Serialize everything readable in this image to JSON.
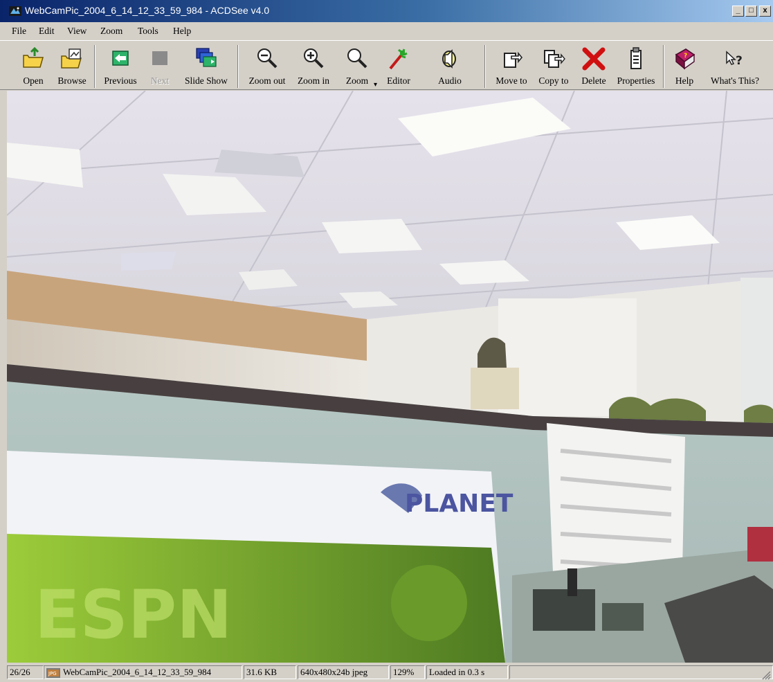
{
  "window": {
    "title": "WebCamPic_2004_6_14_12_33_59_984 - ACDSee v4.0",
    "controls": {
      "minimize": "_",
      "maximize": "□",
      "close": "x"
    }
  },
  "menu": [
    "File",
    "Edit",
    "View",
    "Zoom",
    "Tools",
    "Help"
  ],
  "toolbar": {
    "open": {
      "label": "Open",
      "icon": "folder-open-icon"
    },
    "browse": {
      "label": "Browse",
      "icon": "browse-icon"
    },
    "previous": {
      "label": "Previous",
      "icon": "previous-arrow-icon"
    },
    "next": {
      "label": "Next",
      "icon": "next-disabled-icon",
      "enabled": false
    },
    "slideshow": {
      "label": "Slide Show",
      "icon": "slideshow-icon"
    },
    "zoom_out": {
      "label": "Zoom out",
      "icon": "zoom-out-icon"
    },
    "zoom_in": {
      "label": "Zoom in",
      "icon": "zoom-in-icon"
    },
    "zoom": {
      "label": "Zoom",
      "icon": "zoom-icon"
    },
    "editor": {
      "label": "Editor",
      "icon": "editor-wand-icon"
    },
    "audio": {
      "label": "Audio",
      "icon": "speaker-icon"
    },
    "move_to": {
      "label": "Move to",
      "icon": "move-to-icon"
    },
    "copy_to": {
      "label": "Copy to",
      "icon": "copy-to-icon"
    },
    "delete": {
      "label": "Delete",
      "icon": "delete-x-icon"
    },
    "properties": {
      "label": "Properties",
      "icon": "properties-icon"
    },
    "help": {
      "label": "Help",
      "icon": "help-book-icon"
    },
    "whats_this": {
      "label": "What's This?",
      "icon": "whats-this-cursor-icon"
    }
  },
  "status": {
    "position": "26/26",
    "filename": "WebCamPic_2004_6_14_12_33_59_984",
    "filesize": "31.6 KB",
    "dimensions": "640x480x24b jpeg",
    "zoom": "129%",
    "load_time": "Loaded in 0.3 s",
    "file_icon": "jpg-file-icon"
  },
  "colors": {
    "titlebar_start": "#0a246a",
    "titlebar_end": "#a6caf0",
    "chrome": "#d4d0c8"
  }
}
